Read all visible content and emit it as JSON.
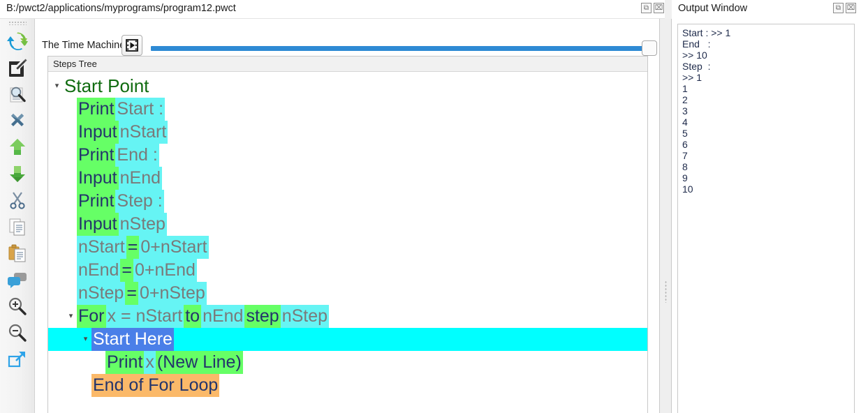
{
  "window": {
    "path": "B:/pwct2/applications/myprograms/program12.pwct",
    "restore_label": "⧉",
    "close_label": "⌧"
  },
  "toolbar": {
    "time_machine_label": "The Time Machine",
    "play_icon": "film-play-icon",
    "slider_value": "100"
  },
  "rail": {
    "items": [
      {
        "name": "sync-icon",
        "label": "Sync"
      },
      {
        "name": "edit-icon",
        "label": "Edit"
      },
      {
        "name": "search-doc-icon",
        "label": "Search"
      },
      {
        "name": "delete-icon",
        "label": "Delete"
      },
      {
        "name": "move-up-icon",
        "label": "Move Up"
      },
      {
        "name": "move-down-icon",
        "label": "Move Down"
      },
      {
        "name": "cut-icon",
        "label": "Cut"
      },
      {
        "name": "copy-icon",
        "label": "Copy"
      },
      {
        "name": "paste-icon",
        "label": "Paste"
      },
      {
        "name": "comment-icon",
        "label": "Comment"
      },
      {
        "name": "zoom-in-icon",
        "label": "Zoom In"
      },
      {
        "name": "zoom-out-icon",
        "label": "Zoom Out"
      },
      {
        "name": "expand-icon",
        "label": "Expand"
      }
    ]
  },
  "tree": {
    "header": "Steps Tree",
    "rows": [
      {
        "indent": 0,
        "expander": "▾",
        "type": "root",
        "segments": [
          {
            "text": "Start Point",
            "style": "root"
          }
        ]
      },
      {
        "indent": 1,
        "expander": "",
        "type": "step",
        "segments": [
          {
            "text": "Print",
            "style": "kw"
          },
          {
            "text": "Start :",
            "style": "val"
          }
        ]
      },
      {
        "indent": 1,
        "expander": "",
        "type": "step",
        "segments": [
          {
            "text": "Input",
            "style": "kw"
          },
          {
            "text": "nStart",
            "style": "val"
          }
        ]
      },
      {
        "indent": 1,
        "expander": "",
        "type": "step",
        "segments": [
          {
            "text": "Print",
            "style": "kw"
          },
          {
            "text": "End    :",
            "style": "val"
          }
        ]
      },
      {
        "indent": 1,
        "expander": "",
        "type": "step",
        "segments": [
          {
            "text": "Input",
            "style": "kw"
          },
          {
            "text": "nEnd",
            "style": "val"
          }
        ]
      },
      {
        "indent": 1,
        "expander": "",
        "type": "step",
        "segments": [
          {
            "text": "Print",
            "style": "kw"
          },
          {
            "text": "Step   :",
            "style": "val"
          }
        ]
      },
      {
        "indent": 1,
        "expander": "",
        "type": "step",
        "segments": [
          {
            "text": "Input",
            "style": "kw"
          },
          {
            "text": "nStep",
            "style": "val"
          }
        ]
      },
      {
        "indent": 1,
        "expander": "",
        "type": "step",
        "segments": [
          {
            "text": "nStart",
            "style": "val"
          },
          {
            "text": "=",
            "style": "kw"
          },
          {
            "text": "0+nStart",
            "style": "val"
          }
        ]
      },
      {
        "indent": 1,
        "expander": "",
        "type": "step",
        "segments": [
          {
            "text": "nEnd",
            "style": "val"
          },
          {
            "text": "=",
            "style": "kw"
          },
          {
            "text": "0+nEnd",
            "style": "val"
          }
        ]
      },
      {
        "indent": 1,
        "expander": "",
        "type": "step",
        "segments": [
          {
            "text": "nStep",
            "style": "val"
          },
          {
            "text": "=",
            "style": "kw"
          },
          {
            "text": "0+nStep",
            "style": "val"
          }
        ]
      },
      {
        "indent": 1,
        "expander": "▾",
        "type": "step",
        "segments": [
          {
            "text": "For",
            "style": "kw"
          },
          {
            "text": "x = nStart",
            "style": "val"
          },
          {
            "text": "to",
            "style": "kw"
          },
          {
            "text": "nEnd",
            "style": "val"
          },
          {
            "text": "step",
            "style": "kw"
          },
          {
            "text": "nStep",
            "style": "val"
          }
        ]
      },
      {
        "indent": 2,
        "expander": "▾",
        "type": "selected",
        "segments": [
          {
            "text": "Start Here",
            "style": "selected"
          }
        ]
      },
      {
        "indent": 3,
        "expander": "",
        "type": "step",
        "segments": [
          {
            "text": "Print",
            "style": "kw"
          },
          {
            "text": "x",
            "style": "val"
          },
          {
            "text": "(New Line)",
            "style": "kw"
          }
        ]
      },
      {
        "indent": 2,
        "expander": "",
        "type": "end",
        "segments": [
          {
            "text": "End of For Loop",
            "style": "end"
          }
        ]
      }
    ]
  },
  "output": {
    "title": "Output Window",
    "restore_label": "⧉",
    "close_label": "⌧",
    "lines": [
      "Start : >> 1",
      "End   :",
      ">> 10",
      "Step  :",
      ">> 1",
      "1",
      "2",
      "3",
      "4",
      "5",
      "6",
      "7",
      "8",
      "9",
      "10"
    ]
  },
  "colors": {
    "keyword_bg": "#66ff66",
    "value_bg": "#66f4f4",
    "selection_bg": "#4a7fe8",
    "selected_row_bg": "#00ffff",
    "end_loop_bg": "#fbb969",
    "slider": "#2e8ad4",
    "root_text": "#0f6b0f"
  }
}
